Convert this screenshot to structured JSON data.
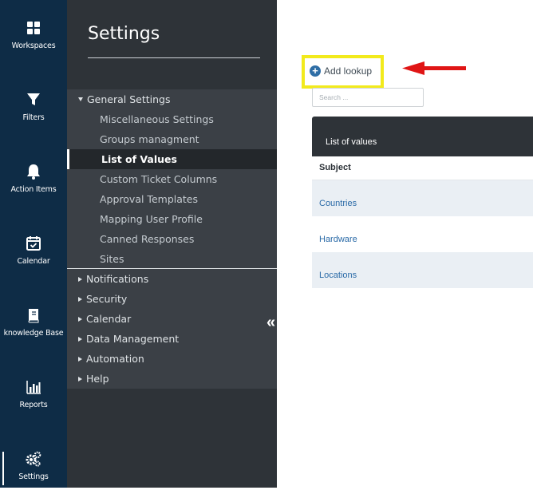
{
  "rail": {
    "items": [
      {
        "label": "Workspaces",
        "icon": "grid-icon"
      },
      {
        "label": "Filters",
        "icon": "funnel-icon"
      },
      {
        "label": "Action Items",
        "icon": "bell-icon"
      },
      {
        "label": "Calendar",
        "icon": "calendar-icon"
      },
      {
        "label": "knowledge Base",
        "icon": "book-icon"
      },
      {
        "label": "Reports",
        "icon": "bar-chart-icon"
      },
      {
        "label": "Settings",
        "icon": "gears-icon"
      }
    ],
    "active": "Settings"
  },
  "panel": {
    "title": "Settings",
    "general": {
      "label": "General Settings",
      "items": [
        "Miscellaneous Settings",
        "Groups managment",
        "List of Values",
        "Custom Ticket Columns",
        "Approval Templates",
        "Mapping User Profile",
        "Canned Responses",
        "Sites"
      ],
      "active": "List of Values"
    },
    "groups": [
      "Notifications",
      "Security",
      "Calendar",
      "Data Management",
      "Automation",
      "Help"
    ],
    "collapse_glyph": "«"
  },
  "main": {
    "add_button": "Add lookup",
    "search_placeholder": "Search ...",
    "table_title": "List of values",
    "column": "Subject",
    "rows": [
      "Countries",
      "Hardware",
      "Locations"
    ]
  },
  "colors": {
    "rail_bg": "#0e2c46",
    "panel_bg": "#2e3338",
    "highlight_box": "#f2ea1c",
    "annotation_arrow": "#e01515",
    "link": "#2a6aa7"
  }
}
